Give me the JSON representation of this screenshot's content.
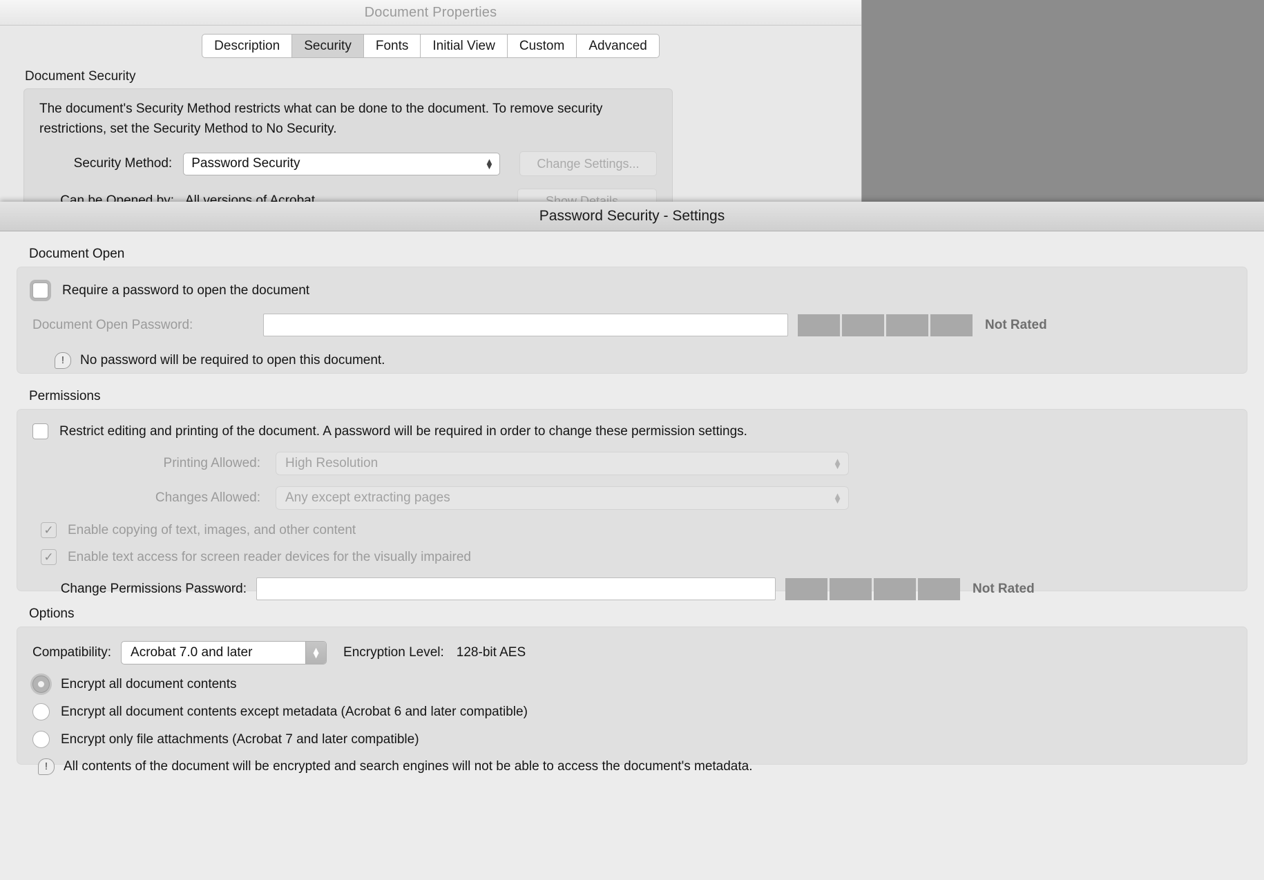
{
  "document_properties": {
    "title": "Document Properties",
    "tabs": [
      {
        "label": "Description",
        "selected": false
      },
      {
        "label": "Security",
        "selected": true
      },
      {
        "label": "Fonts",
        "selected": false
      },
      {
        "label": "Initial View",
        "selected": false
      },
      {
        "label": "Custom",
        "selected": false
      },
      {
        "label": "Advanced",
        "selected": false
      }
    ],
    "group_label": "Document Security",
    "description": "The document's Security Method restricts what can be done to the document. To remove security restrictions, set the Security Method to No Security.",
    "security_method_label": "Security Method:",
    "security_method_value": "Password Security",
    "change_settings_button": "Change Settings...",
    "can_be_opened_by_label": "Can be Opened by:",
    "can_be_opened_by_value": "All versions of Acrobat",
    "show_details_button": "Show Details..."
  },
  "password_security": {
    "title": "Password Security - Settings",
    "document_open": {
      "section_label": "Document Open",
      "require_password_checkbox": "Require a password to open the document",
      "require_password_checked": false,
      "open_password_label": "Document Open Password:",
      "open_password_value": "",
      "strength_segments": 4,
      "strength_label": "Not Rated",
      "note": "No password will be required to open this document."
    },
    "permissions": {
      "section_label": "Permissions",
      "restrict_checkbox": "Restrict editing and printing of the document. A password will be required in order to change these permission settings.",
      "restrict_checked": false,
      "printing_allowed_label": "Printing Allowed:",
      "printing_allowed_value": "High Resolution",
      "changes_allowed_label": "Changes Allowed:",
      "changes_allowed_value": "Any except extracting pages",
      "enable_copying_checkbox": "Enable copying of text, images, and other content",
      "enable_copying_checked": true,
      "enable_screen_reader_checkbox": "Enable text access for screen reader devices for the visually impaired",
      "enable_screen_reader_checked": true,
      "permissions_password_label": "Change Permissions Password:",
      "permissions_password_value": "",
      "strength_segments": 4,
      "strength_label": "Not Rated"
    },
    "options": {
      "section_label": "Options",
      "compatibility_label": "Compatibility:",
      "compatibility_value": "Acrobat 7.0 and later",
      "encryption_level_label": "Encryption  Level:",
      "encryption_level_value": "128-bit AES",
      "radios": [
        {
          "label": "Encrypt all document contents",
          "selected": true
        },
        {
          "label": "Encrypt all document contents except metadata (Acrobat 6 and later compatible)",
          "selected": false
        },
        {
          "label": "Encrypt only file attachments (Acrobat 7 and later compatible)",
          "selected": false
        }
      ],
      "note": "All contents of the document will be encrypted and search engines will not be able to access the document's metadata."
    }
  },
  "icons": {
    "warning": "!",
    "stepper_up": "▲",
    "stepper_down": "▼",
    "checkmark": "✓"
  },
  "colors": {
    "backdrop": "#8c8c8c",
    "sheet_background": "#ececec",
    "panel_background": "#e0e0e0",
    "meter_segment": "#a9a9a9",
    "disabled_text": "#9b9b9b"
  }
}
